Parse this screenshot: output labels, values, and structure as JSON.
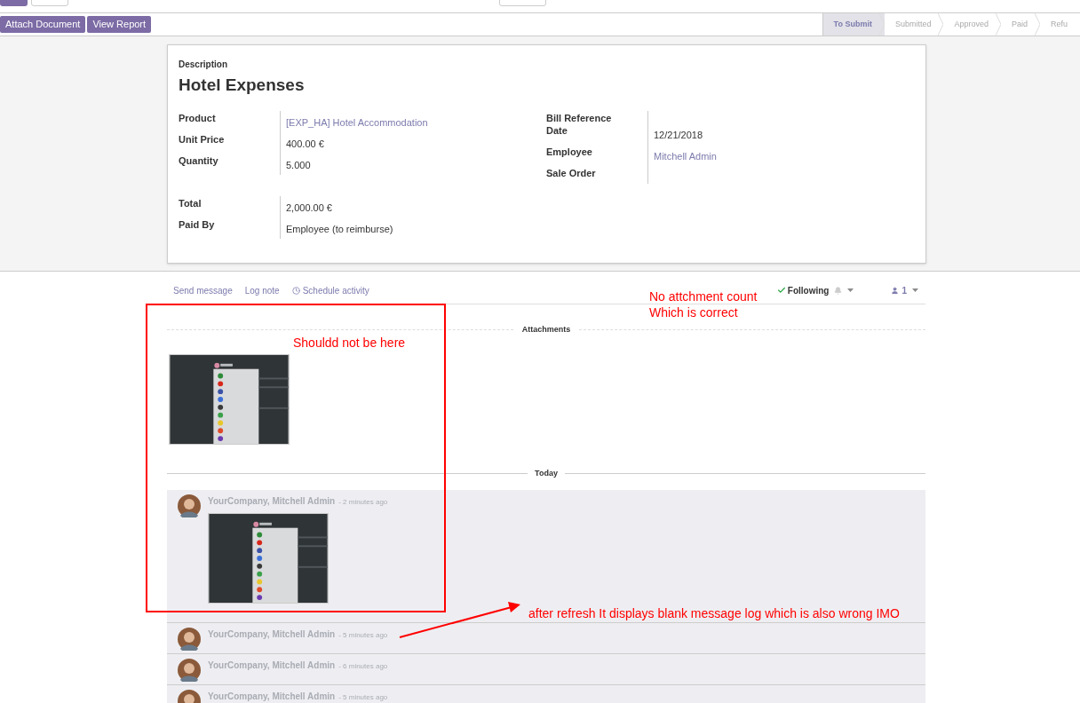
{
  "action_buttons": [
    "Attach Document",
    "View Report"
  ],
  "stages": [
    {
      "label": "To Submit",
      "selected": true
    },
    {
      "label": "Submitted",
      "selected": false
    },
    {
      "label": "Approved",
      "selected": false
    },
    {
      "label": "Paid",
      "selected": false
    },
    {
      "label": "Refu",
      "selected": false
    }
  ],
  "form": {
    "description_label": "Description",
    "title": "Hotel Expenses",
    "left_fields": [
      {
        "label": "Product",
        "value": "[EXP_HA] Hotel Accommodation",
        "link": true
      },
      {
        "label": "Unit Price",
        "value": "400.00 €",
        "link": false
      },
      {
        "label": "Quantity",
        "value": "5.000",
        "link": false
      }
    ],
    "right_fields": [
      {
        "label": "Bill Reference"
      },
      {
        "label": "Date",
        "value": "12/21/2018",
        "link": false
      },
      {
        "label": "Employee",
        "value": "Mitchell Admin",
        "link": true
      },
      {
        "label": "Sale Order"
      }
    ],
    "bottom_fields": [
      {
        "label": "Total",
        "value": "2,000.00 €",
        "link": false
      },
      {
        "label": "Paid By",
        "value": "Employee (to reimburse)",
        "link": false
      }
    ]
  },
  "chatter": {
    "actions": [
      {
        "label": "Send message",
        "kind": "plain"
      },
      {
        "label": "Log note",
        "kind": "plain"
      },
      {
        "label": "Schedule activity",
        "kind": "clock"
      }
    ],
    "following": "Following",
    "followers": "1",
    "attachments_heading": "Attachments",
    "date_divider": "Today",
    "messages": [
      {
        "author": "YourCompany, Mitchell Admin",
        "time": "- 2 minutes ago"
      },
      {
        "author": "YourCompany, Mitchell Admin",
        "time": "- 5 minutes ago"
      },
      {
        "author": "YourCompany, Mitchell Admin",
        "time": "- 6 minutes ago"
      },
      {
        "author": "YourCompany, Mitchell Admin",
        "time": "- 5 minutes ago"
      }
    ]
  },
  "annotations": [
    {
      "kind": "note",
      "text": "Shouldd not be here"
    },
    {
      "kind": "note",
      "text": "No attchment count\nWhich is correct"
    },
    {
      "kind": "note",
      "text": "after refresh It displays blank message log which is also wrong IMO"
    }
  ]
}
